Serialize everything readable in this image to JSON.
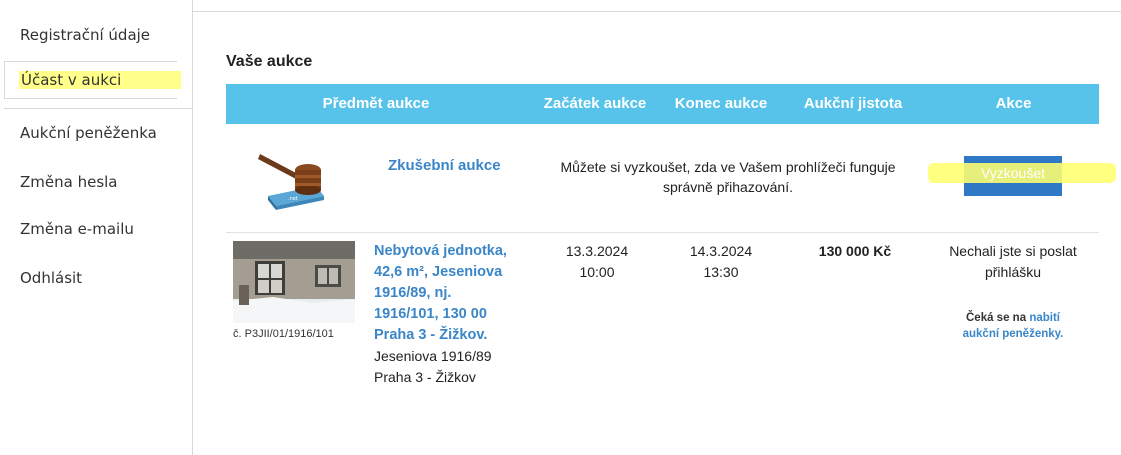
{
  "sidebar": {
    "items": [
      {
        "label": "Registrační údaje"
      },
      {
        "label": "Účast v aukci"
      },
      {
        "label": "Aukční peněženka"
      },
      {
        "label": "Změna hesla"
      },
      {
        "label": "Změna e-mailu"
      },
      {
        "label": "Odhlásit"
      }
    ]
  },
  "main": {
    "title": "Vaše aukce",
    "columns": [
      "Předmět aukce",
      "Začátek aukce",
      "Konec aukce",
      "Aukční jistota",
      "Akce"
    ],
    "rows": [
      {
        "name": "Zkušební aukce",
        "description_line1": "Můžete si vyzkoušet, zda ve Vašem prohlížeči funguje",
        "description_line2": "správně přihazování.",
        "action_label": "Vyzkoušet"
      },
      {
        "id": "č. P3JII/01/1916/101",
        "title_lines": [
          "Nebytová jednotka,",
          "42,6 m², Jeseniova",
          "1916/89, nj.",
          "1916/101, 130 00",
          "Praha 3 - Žižkov."
        ],
        "address_lines": [
          "Jeseniova 1916/89",
          "Praha 3 - Žižkov"
        ],
        "start_date": "13.3.2024",
        "start_time": "10:00",
        "end_date": "14.3.2024",
        "end_time": "13:30",
        "deposit": "130 000 Kč",
        "status_line1": "Nechali jste si poslat",
        "status_line2": "přihlášku",
        "wait_prefix": "Čeká se na",
        "wait_link_part1": "nabití",
        "wait_link_part2": "aukční peněženky."
      }
    ]
  },
  "colors": {
    "header_bg": "#58c3ea",
    "link": "#3a86c8",
    "button_bg": "#2f78c6",
    "highlight": "#ffff8a"
  }
}
